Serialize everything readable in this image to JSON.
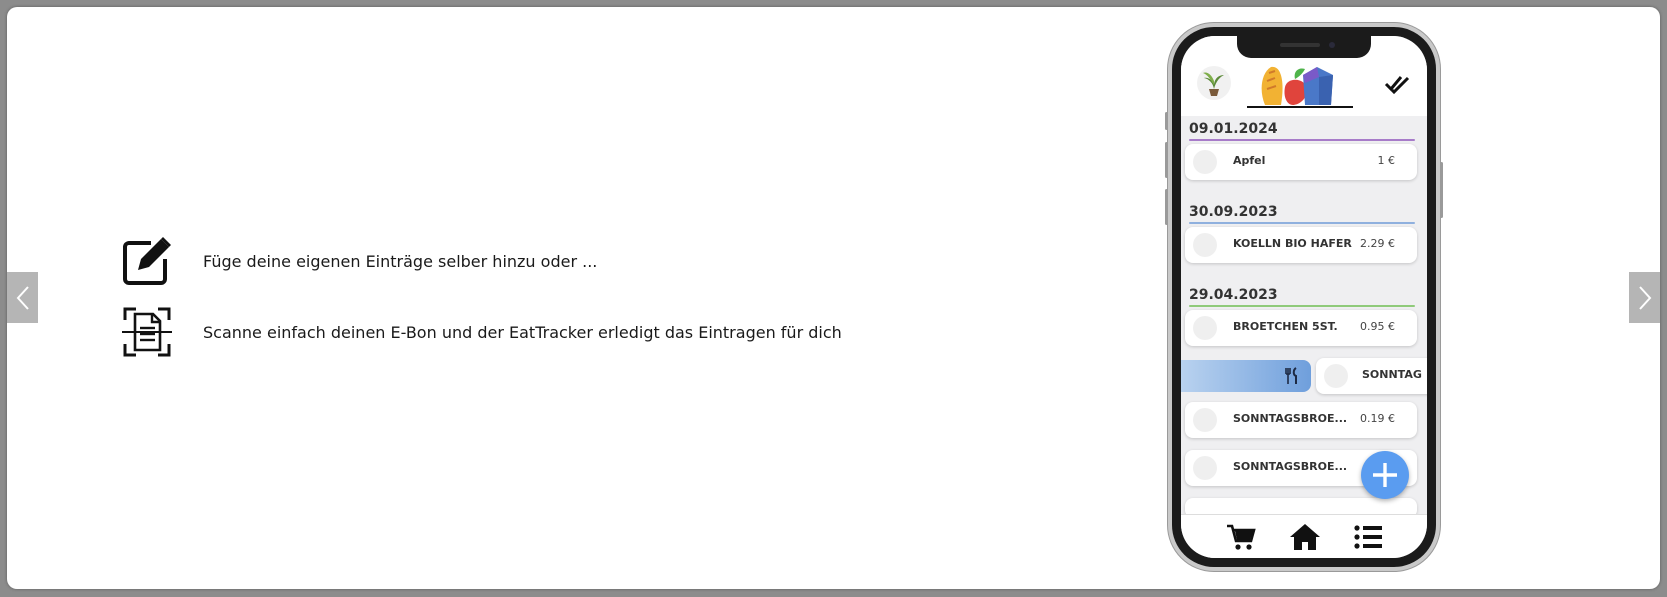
{
  "navigation": {
    "prev_icon": "chevron-left-icon",
    "next_icon": "chevron-right-icon"
  },
  "features": [
    {
      "icon": "edit-icon",
      "text": "Füge deine eigenen Einträge selber hinzu oder ..."
    },
    {
      "icon": "scan-receipt-icon",
      "text": "Scanne einfach deinen E-Bon und der EatTracker erledigt das Eintragen für dich"
    }
  ],
  "phone": {
    "header": {
      "left_icon": "plant-icon",
      "logo": "groceries-logo",
      "right_icon": "double-check-icon"
    },
    "groups": [
      {
        "date": "09.01.2024",
        "color": "#a77bc9",
        "items": [
          {
            "name": "Apfel",
            "price": "1 €"
          }
        ]
      },
      {
        "date": "30.09.2023",
        "color": "#8fb0de",
        "items": [
          {
            "name": "KOELLN BIO HAFER",
            "price": "2.29 €"
          }
        ]
      },
      {
        "date": "29.04.2023",
        "color": "#8fca7a",
        "items": [
          {
            "name": "BROETCHEN 5ST.",
            "price": "0.95 €"
          }
        ]
      }
    ],
    "swiped_item": {
      "name": "SONNTAG",
      "action_icon": "fork-knife-icon"
    },
    "more_items": [
      {
        "name": "SONNTAGSBROE...",
        "price": "0.19 €"
      },
      {
        "name": "SONNTAGSBROE...",
        "price": ""
      }
    ],
    "fab_icon": "plus-icon",
    "bottom_nav": [
      "cart-icon",
      "home-icon",
      "list-icon"
    ]
  }
}
